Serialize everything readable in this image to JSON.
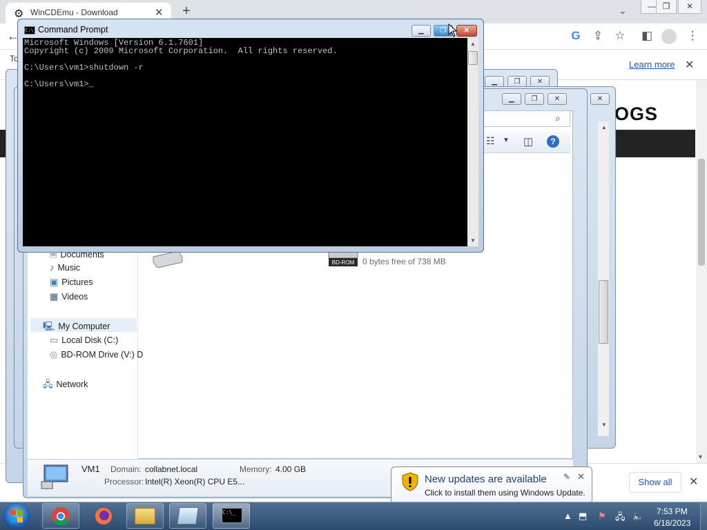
{
  "chrome": {
    "tab_title": "WinCDEmu - Download",
    "tab_close": "✕",
    "new_tab": "+",
    "learn_more": "Learn more",
    "page_heading_fragment": "OGS",
    "left_fragment": "To",
    "show_all": "Show all"
  },
  "cmd": {
    "title": "Command Prompt",
    "icon_text": "C:\\_",
    "lines": "Microsoft Windows [Version 6.1.7601]\nCopyright (c) 2009 Microsoft Corporation.  All rights reserved.\n\nC:\\Users\\vm1>shutdown -r\n\nC:\\Users\\vm1>_"
  },
  "explorer": {
    "nav": {
      "documents": "Documents",
      "music": "Music",
      "pictures": "Pictures",
      "videos": "Videos",
      "my_computer": "My Computer",
      "local_disk": "Local Disk (C:)",
      "bd_rom": "BD-ROM Drive (V:) D",
      "network": "Network"
    },
    "bd_rom_label": "BD-ROM",
    "bd_rom_free": "0 bytes free of 738 MB",
    "details": {
      "name": "VM1",
      "domain_label": "Domain:",
      "domain_value": "collabnet.local",
      "memory_label": "Memory:",
      "memory_value": "4.00 GB",
      "processor_label": "Processor:",
      "processor_value": "Intel(R) Xeon(R) CPU E5..."
    }
  },
  "notification": {
    "title": "New updates are available",
    "text": "Click to install them using Windows Update."
  },
  "taskbar": {
    "time": "7:53 PM",
    "date": "6/18/2023"
  }
}
